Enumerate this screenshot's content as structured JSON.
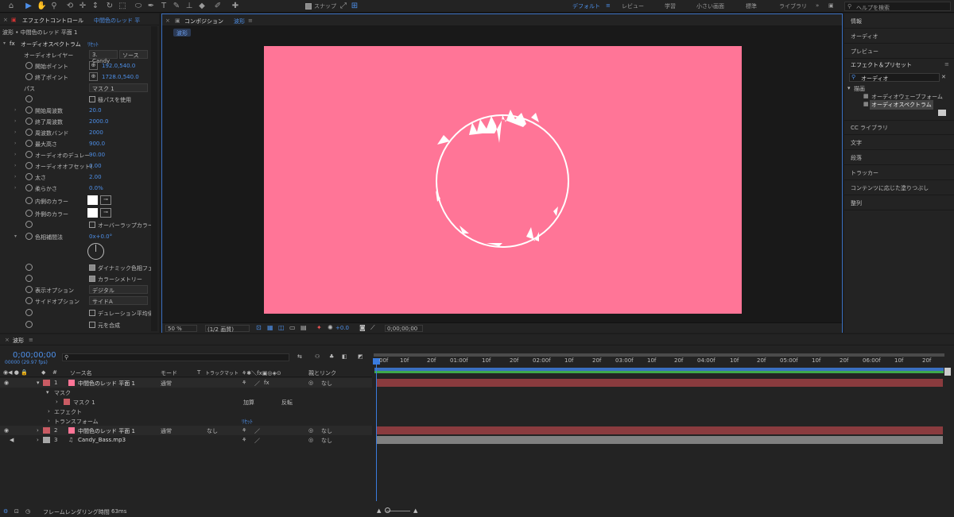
{
  "toolbar": {
    "snap_label": "スナップ",
    "workspaces": [
      "デフォルト",
      "レビュー",
      "学習",
      "小さい画面",
      "標準",
      "ライブラリ"
    ],
    "search_placeholder": "ヘルプを検索"
  },
  "effect_panel": {
    "tab_title": "エフェクトコントロール",
    "tab_layer": "中間色のレッド 平",
    "breadcrumb": "波形 • 中間色のレッド 平面 1",
    "effect_name": "オーディオスペクトラム",
    "reset": "ﾘｾｯﾄ",
    "audio_layer_label": "オーディオレイヤー",
    "audio_layer_value": "3. Candy",
    "audio_source": "ソース",
    "start_point_label": "開始ポイント",
    "start_point": "192.0,540.0",
    "end_point_label": "終了ポイント",
    "end_point": "1728.0,540.0",
    "path_label": "パス",
    "path_value": "マスク 1",
    "polar_label": "極パスを使用",
    "start_freq_label": "開始周波数",
    "start_freq": "20.0",
    "end_freq_label": "終了周波数",
    "end_freq": "2000.0",
    "bands_label": "周波数バンド",
    "bands": "2000",
    "max_height_label": "最大高さ",
    "max_height": "900.0",
    "duration_label": "オーディオのデュレー",
    "duration": "90.00",
    "offset_label": "オーディオオフセット(",
    "offset": "0.00",
    "thickness_label": "太さ",
    "thickness": "2.00",
    "softness_label": "柔らかさ",
    "softness": "0.0%",
    "inner_color_label": "内側のカラー",
    "outer_color_label": "外側のカラー",
    "overlap_label": "オーバーラップカラー",
    "hue_label": "色相補間法",
    "hue_value": "0x+0.0°",
    "dynamic_label": "ダイナミック色相フェ",
    "metric_label": "カラーシメトリー",
    "display_label": "表示オプション",
    "display_value": "デジタル",
    "side_label": "サイドオプション",
    "side_value": "サイドA",
    "avg_label": "デュレーション平均化",
    "composite_label": "元を合成"
  },
  "comp_panel": {
    "title": "コンポジション",
    "comp_name": "波形",
    "tab": "波形",
    "zoom": "50 %",
    "resolution": "(1/2 画質)",
    "exposure": "+0.0",
    "timecode": "0;00;00;00",
    "bg_color": "#FF7597"
  },
  "right_panel": {
    "items_top": [
      "情報",
      "オーディオ",
      "プレビュー"
    ],
    "effects_title": "エフェクト＆プリセット",
    "search_value": "オーディオ",
    "category": "描画",
    "effects": [
      "オーディオウェーブフォーム",
      "オーディオスペクトラム"
    ],
    "items_bottom": [
      "CC ライブラリ",
      "文字",
      "段落",
      "トラッカー",
      "コンテンツに応じた塗りつぶし",
      "整列"
    ]
  },
  "timeline": {
    "tab": "波形",
    "timecode": "0;00;00;00",
    "fps": "00000 (29.97 fps)",
    "col_source": "ソース名",
    "col_mode": "モード",
    "col_t": "T",
    "col_matte": "トラックマット",
    "col_parent": "親とリンク",
    "ruler": [
      "00f",
      "10f",
      "20f",
      "01:00f",
      "10f",
      "20f",
      "02:00f",
      "10f",
      "20f",
      "03:00f",
      "10f",
      "20f",
      "04:00f",
      "10f",
      "20f",
      "05:00f",
      "10f",
      "20f",
      "06:00f",
      "10f",
      "20f"
    ],
    "layers": [
      {
        "num": "1",
        "name": "中間色のレッド 平面 1",
        "mode": "通常",
        "parent": "なし"
      },
      {
        "num": "2",
        "name": "中間色のレッド 平面 1",
        "mode": "通常",
        "matte": "なし",
        "parent": "なし"
      },
      {
        "num": "3",
        "name": "Candy_Bass.mp3",
        "parent": "なし"
      }
    ],
    "mask_group": "マスク",
    "mask_name": "マスク 1",
    "mask_mode": "加算",
    "mask_invert": "反転",
    "effects_group": "エフェクト",
    "transform_group": "トランスフォーム",
    "reset": "ﾘｾｯﾄ",
    "status": "フレームレンダリング時間",
    "render_time": "63ms"
  }
}
